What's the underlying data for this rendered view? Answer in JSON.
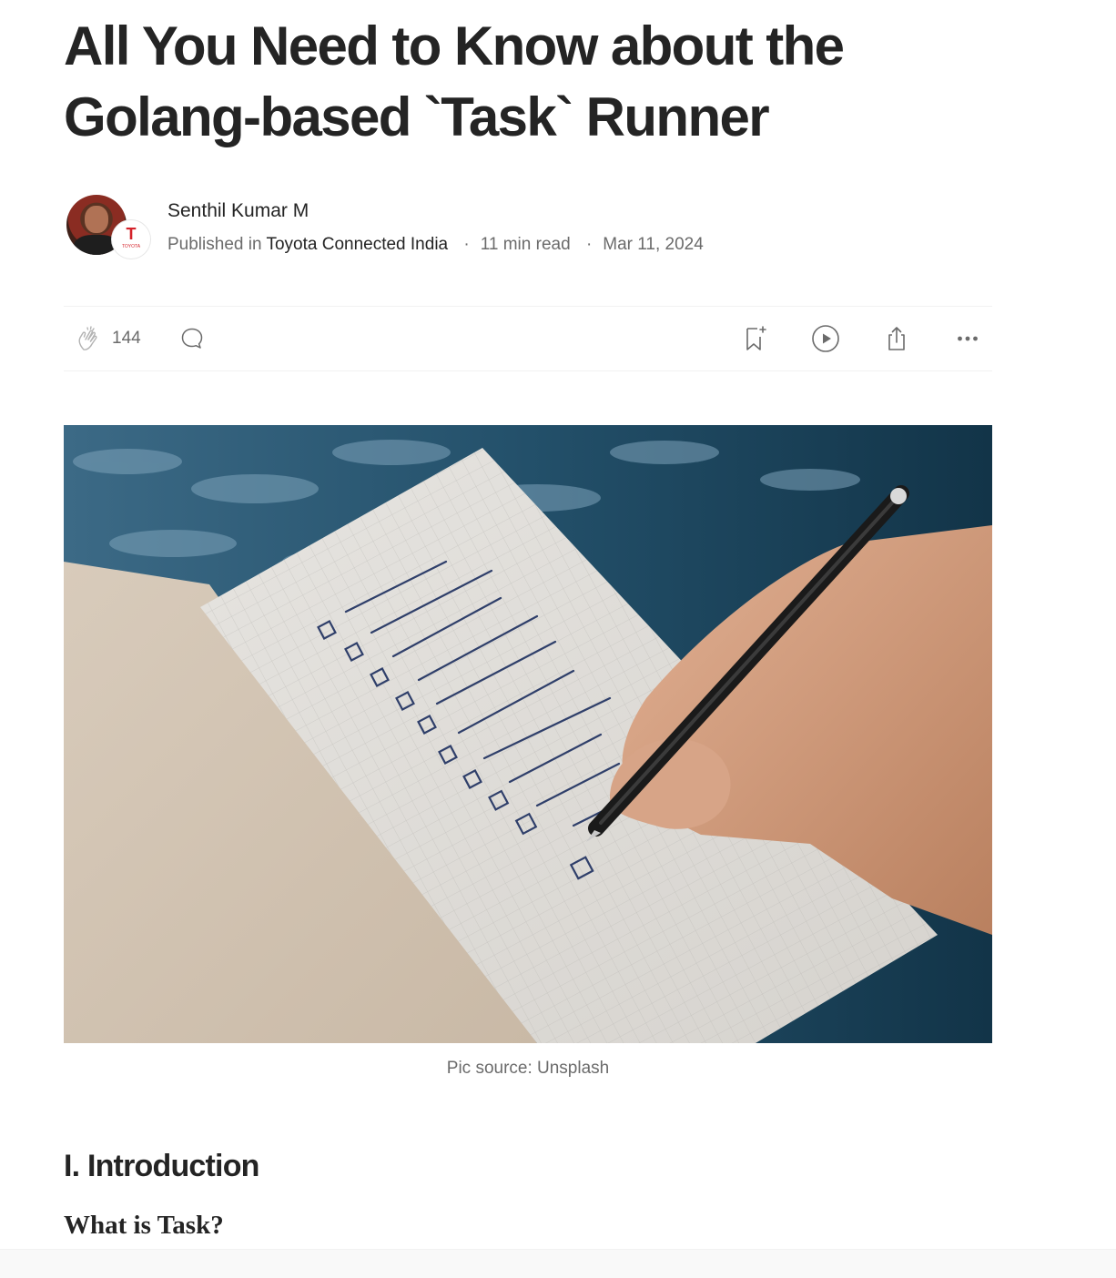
{
  "article": {
    "title_line1": "All You Need to Know about the",
    "title_line2": "Golang-based `Task` Runner"
  },
  "byline": {
    "author": "Senthil Kumar M",
    "published_in_label": "Published in",
    "publication": "Toyota Connected India",
    "read_time": "11 min read",
    "date": "Mar 11, 2024",
    "separator": "·",
    "badge_letter": "T",
    "badge_text": "TOYOTA"
  },
  "actions": {
    "clap_count": "144",
    "icons": [
      "clap-icon",
      "comment-icon",
      "bookmark-add-icon",
      "play-circle-icon",
      "share-icon",
      "more-horizontal-icon"
    ]
  },
  "hero": {
    "caption": "Pic source: Unsplash"
  },
  "body": {
    "section_heading": "I. Introduction",
    "subheading": "What is Task?"
  },
  "colors": {
    "text": "#242424",
    "muted": "#6b6b6b",
    "divider": "#f2f2f2",
    "badge_red": "#d4222a"
  }
}
